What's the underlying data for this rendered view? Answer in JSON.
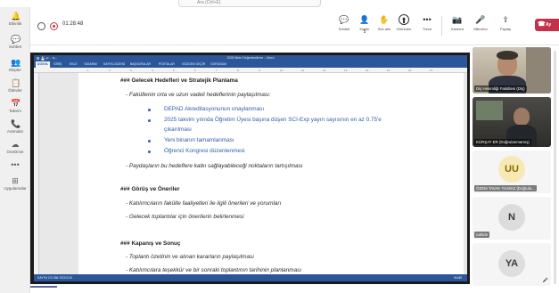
{
  "search": {
    "placeholder": "Ara (Ctrl+E)"
  },
  "rail": [
    {
      "icon": "activity-icon",
      "glyph": "🔔",
      "label": "Etkinlik"
    },
    {
      "icon": "chat-icon",
      "glyph": "💬",
      "label": "Sohbet"
    },
    {
      "icon": "teams-icon",
      "glyph": "👥",
      "label": "Ekipler"
    },
    {
      "icon": "assignments-icon",
      "glyph": "📋",
      "label": "Ödevler"
    },
    {
      "icon": "calendar-icon",
      "glyph": "📅",
      "label": "Takvim"
    },
    {
      "icon": "calls-icon",
      "glyph": "📞",
      "label": "Aramalar"
    },
    {
      "icon": "onedrive-icon",
      "glyph": "☁",
      "label": "OneDrive"
    },
    {
      "icon": "more-icon",
      "glyph": "•••",
      "label": ""
    },
    {
      "icon": "apps-icon",
      "glyph": "⊞",
      "label": "Uygulamalar"
    }
  ],
  "meeting": {
    "timer": "01:28:48",
    "buttons": [
      {
        "key": "chat",
        "icon": "chat-icon",
        "glyph": "💬",
        "label": "Sohbet"
      },
      {
        "key": "people",
        "icon": "people-icon",
        "glyph": "👤",
        "label": "Kişiler",
        "badge": "5"
      },
      {
        "key": "raise",
        "icon": "hand-icon",
        "glyph": "✋",
        "label": "Söz alın"
      },
      {
        "key": "share",
        "icon": "share-icon",
        "glyph": "⬆",
        "label": "Görünüm"
      },
      {
        "key": "more",
        "icon": "more-icon",
        "glyph": "•••",
        "label": "Tümü"
      },
      {
        "key": "camera",
        "icon": "camera-icon",
        "glyph": "📷",
        "label": "Kamera"
      },
      {
        "key": "mic",
        "icon": "microphone-icon",
        "glyph": "🎤",
        "label": "Mikrofon"
      },
      {
        "key": "sharescreen",
        "icon": "share-screen-icon",
        "glyph": "⇪",
        "label": "Paylaş"
      }
    ],
    "leave_label": "Ay"
  },
  "word": {
    "title": "2025 Birim Değerlendirme – Word",
    "qat": "⊞ 💾 ↶ · ↷ ·",
    "tabs": [
      "DOSYA",
      "GİRİŞ",
      "EKLE",
      "TASARIM",
      "SAYFA DÜZENİ",
      "BAŞVURULAR",
      "POSTALAR",
      "GÖZDEN GEÇİR",
      "GÖRÜNÜM"
    ],
    "share_label": "Ekt PAYLAŞ",
    "ruler_ticks": [
      "1",
      "2",
      "3",
      "4",
      "5",
      "6",
      "7",
      "8",
      "9",
      "10",
      "11",
      "12",
      "13",
      "14",
      "15",
      "16",
      "17"
    ],
    "status": "SAYFA 2/3   386 SÖZCÜK",
    "zoom": "%140"
  },
  "document": {
    "h1": "### Gelecek Hedefleri ve Stratejik Planlama",
    "p1": "- Fakültenin orta ve uzun vadeli hedeflerinin paylaşılması:",
    "b1": "DEPAD Akreditasyonunun onaylanması",
    "b2a": "2025 takvim yılında Öğretim Üyesi başına düşen SCI-Exp yayın sayısının en az 0.75'e",
    "b2b": "çıkarılması",
    "b3": "Yeni binanın tamamlanması",
    "b4": "Öğrenci Kongresi düzenlenmesi",
    "p2": "- Paydaşların bu hedeflere katkı sağlayabileceği noktaların tartışılması",
    "h2": "### Görüş ve Öneriler",
    "p3": "- Katılımcıların fakülte faaliyetleri ile ilgili önerileri ve yorumları",
    "p4": "- Gelecek toplantılar için önerilerin belirlenmesi",
    "h3": "### Kapanış ve Sonuç",
    "p5": "- Toplantı özetinin ve alınan kararların paylaşılması",
    "p6": "- Katılımcılara teşekkür ve bir sonraki toplantının tarihinin planlanması"
  },
  "participants": [
    {
      "name": "Diş Hekimliği Fakültesi (Diş)",
      "kind": "video"
    },
    {
      "name": "KÜRŞAT ER (Doğrulanmamış)",
      "kind": "video"
    },
    {
      "name": "ÖZEM TAVAK YILMAZ (Doğrula...",
      "initials": "UU",
      "kind": "avatar",
      "color": "#8a6d00",
      "bg": "#f7e9b5"
    },
    {
      "name": "nahide",
      "initials": "N",
      "kind": "avatar",
      "color": "#3b3b3b",
      "bg": "#dcdcdc"
    },
    {
      "name": "",
      "initials": "YA",
      "kind": "avatar",
      "color": "#3b3b3b",
      "bg": "#dedede"
    }
  ]
}
